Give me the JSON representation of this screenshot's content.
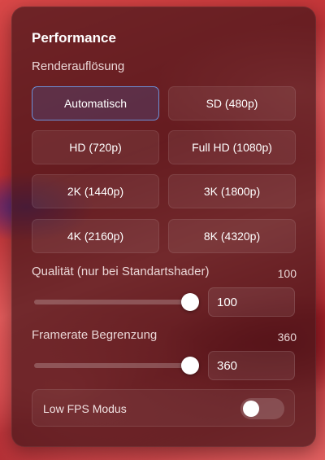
{
  "panel": {
    "title": "Performance",
    "resolution": {
      "label": "Renderauflösung",
      "options": [
        "Automatisch",
        "SD (480p)",
        "HD (720p)",
        "Full HD (1080p)",
        "2K (1440p)",
        "3K (1800p)",
        "4K (2160p)",
        "8K (4320p)"
      ],
      "selected": "Automatisch"
    },
    "quality": {
      "label": "Qualität (nur bei Standartshader)",
      "display_value": "100",
      "input_value": "100",
      "level_fraction": 1.0
    },
    "framerate": {
      "label": "Framerate Begrenzung",
      "display_value": "360",
      "input_value": "360",
      "level_fraction": 1.0
    },
    "low_fps": {
      "label": "Low FPS Modus",
      "enabled": false
    }
  },
  "colors": {
    "accent_border": "#6c8fd6",
    "panel_bg": "#46161a"
  }
}
